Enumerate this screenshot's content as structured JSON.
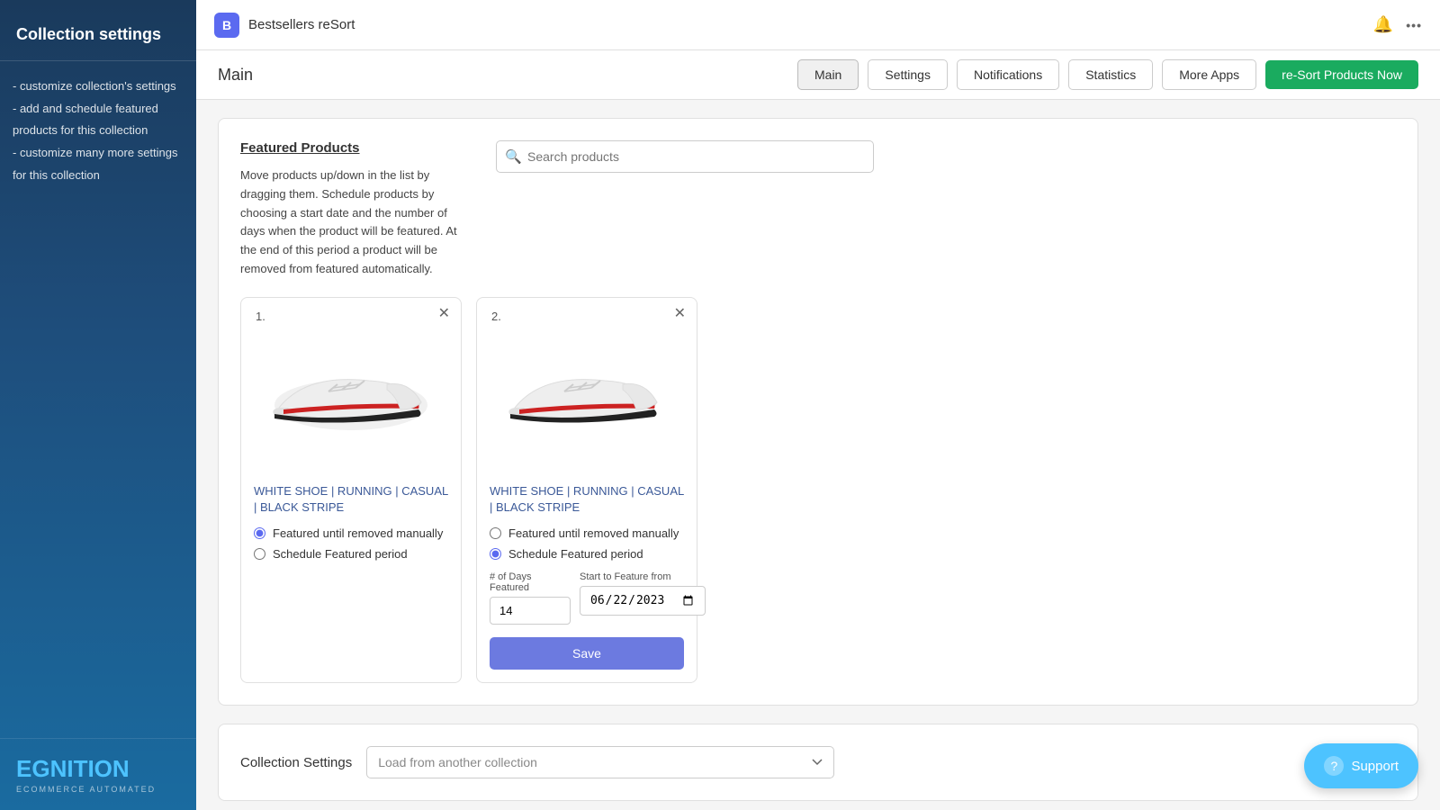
{
  "sidebar": {
    "title": "Collection settings",
    "nav_items": [
      "- customize collection's settings",
      "- add and schedule featured products for this collection",
      "- customize many more settings for this collection"
    ],
    "logo": {
      "text_e": "E",
      "text_rest": "GNITION",
      "sub": "ECOMMERCE AUTOMATED"
    }
  },
  "topbar": {
    "app_icon_letter": "B",
    "app_name": "Bestsellers reSort",
    "bell_icon": "🔔",
    "more_icon": "•••"
  },
  "nav": {
    "page_title": "Main",
    "tabs": [
      {
        "label": "Main",
        "active": true
      },
      {
        "label": "Settings",
        "active": false
      },
      {
        "label": "Notifications",
        "active": false
      },
      {
        "label": "Statistics",
        "active": false
      },
      {
        "label": "More Apps",
        "active": false
      }
    ],
    "primary_button": "re-Sort Products Now"
  },
  "featured_products": {
    "section_title": "Featured Products",
    "description": "Move products up/down in the list by dragging them. Schedule products by choosing a start date and the number of days when the product will be featured. At the end of this period a product will be removed from featured automatically.",
    "search_placeholder": "Search products",
    "products": [
      {
        "number": "1.",
        "title": "WHITE SHOE | RUNNING | CASUAL | BLACK STRIPE",
        "radio_option_1": "Featured until removed manually",
        "radio_option_2": "Schedule Featured period",
        "selected_option": "option1"
      },
      {
        "number": "2.",
        "title": "WHITE SHOE | RUNNING | CASUAL | BLACK STRIPE",
        "radio_option_1": "Featured until removed manually",
        "radio_option_2": "Schedule Featured period",
        "selected_option": "option2",
        "days_label": "# of Days Featured",
        "days_value": "14",
        "date_label": "Start to Feature from",
        "date_value": "22/06/2023",
        "save_button": "Save"
      }
    ]
  },
  "collection_settings": {
    "label": "Collection Settings",
    "select_placeholder": "Load from another collection"
  },
  "support": {
    "button_label": "Support"
  }
}
